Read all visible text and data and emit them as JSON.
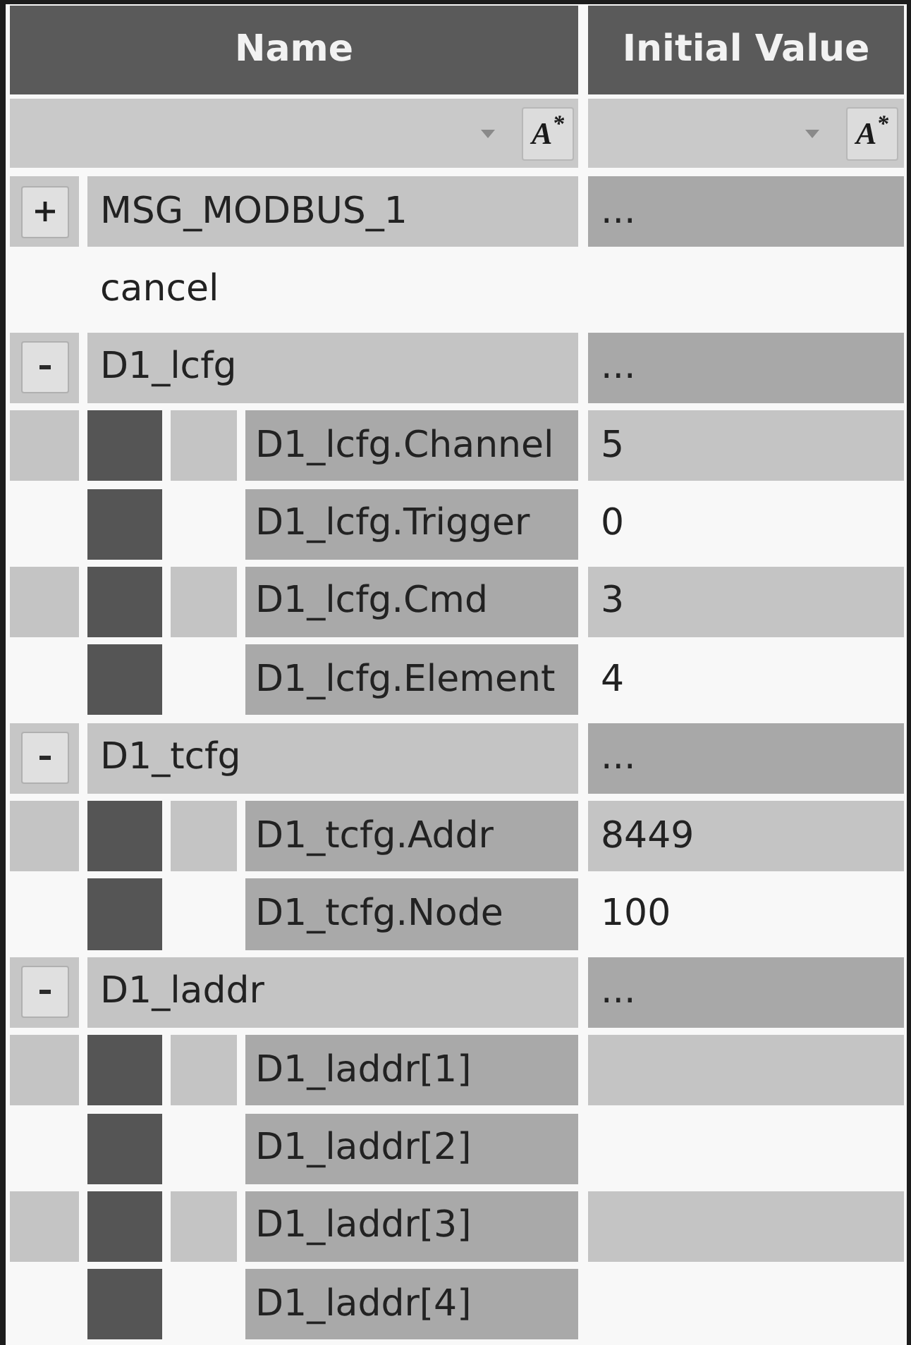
{
  "columns": [
    {
      "label": "Name"
    },
    {
      "label": "Initial Value"
    }
  ],
  "filters": [
    {
      "options_button": "A$^{*}$"
    },
    {
      "options_button": "A$^{*}$"
    }
  ],
  "rows": [
    {
      "kind": "group",
      "name": "MSG_MODBUS_1",
      "value": "...",
      "expanded": false
    },
    {
      "kind": "item",
      "name": "cancel"
    },
    {
      "kind": "group",
      "name": "D1_lcfg",
      "value": "...",
      "expanded": true,
      "children": [
        {
          "name": "D1_lcfg.Channel",
          "value": "5"
        },
        {
          "name": "D1_lcfg.Trigger",
          "value": "0"
        },
        {
          "name": "D1_lcfg.Cmd",
          "value": "3"
        },
        {
          "name": "D1_lcfg.Element",
          "value": "4"
        }
      ]
    },
    {
      "kind": "group",
      "name": "D1_tcfg",
      "value": "...",
      "expanded": true,
      "children": [
        {
          "name": "D1_tcfg.Addr",
          "value": "8449"
        },
        {
          "name": "D1_tcfg.Node",
          "value": "100"
        }
      ]
    },
    {
      "kind": "group",
      "name": "D1_laddr",
      "value": "...",
      "expanded": true,
      "children": [
        {
          "name": "D1_laddr[1]"
        },
        {
          "name": "D1_laddr[2]"
        },
        {
          "name": "D1_laddr[3]"
        },
        {
          "name": "D1_laddr[4]"
        }
      ]
    }
  ]
}
